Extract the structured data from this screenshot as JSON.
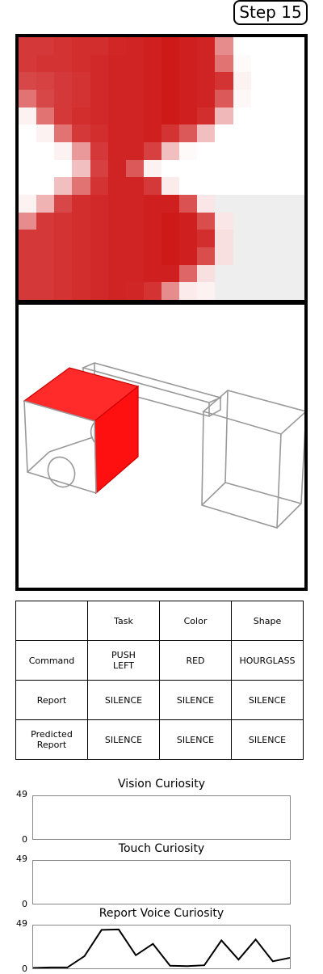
{
  "step_label": "Step 15",
  "vision": {
    "columns": 16,
    "rows": 15,
    "pixels": [
      "RRRRRRRRRRRRRRRRRRRRRRRRRRRRRRRRRRRRRRRRRRRRRRRRRRRRRRRRRRRRRRRRRRRRRRRRRRRRRRRRRRRRRRRRRRRRRRRRRRRRRRRRRRRRRRRRRRRRRRRRRRRRRRRRRRRRRRRRRRRRRRRRRRRRRRRRRRRRRRRRRRRRRRRRRRRRRRRRRRRRRRRRRRRRRRRRRRRRRRRRRRRRRRRRRRRRRRRRRRRRRRRRRRRRRRRRRRRRRRRRRRRRRRRRRRRR"
    ],
    "intensity_rows": [
      [
        0.78,
        0.78,
        0.8,
        0.82,
        0.82,
        0.85,
        0.86,
        0.88,
        0.9,
        0.88,
        0.86,
        0.45,
        0.0,
        0.0,
        0.0,
        0.0
      ],
      [
        0.78,
        0.8,
        0.8,
        0.82,
        0.84,
        0.86,
        0.86,
        0.88,
        0.9,
        0.88,
        0.86,
        0.55,
        0.02,
        0.0,
        0.0,
        0.0
      ],
      [
        0.72,
        0.74,
        0.78,
        0.8,
        0.84,
        0.86,
        0.86,
        0.88,
        0.9,
        0.88,
        0.86,
        0.8,
        0.05,
        0.0,
        0.0,
        0.0
      ],
      [
        0.55,
        0.72,
        0.78,
        0.8,
        0.84,
        0.86,
        0.86,
        0.88,
        0.9,
        0.88,
        0.86,
        0.65,
        0.03,
        0.0,
        0.0,
        0.0
      ],
      [
        0.05,
        0.55,
        0.78,
        0.82,
        0.84,
        0.86,
        0.86,
        0.88,
        0.9,
        0.88,
        0.82,
        0.28,
        0.0,
        0.0,
        0.0,
        0.0
      ],
      [
        0.0,
        0.05,
        0.55,
        0.78,
        0.82,
        0.86,
        0.86,
        0.88,
        0.8,
        0.65,
        0.25,
        0.0,
        0.0,
        0.0,
        0.0,
        0.0
      ],
      [
        0.0,
        0.0,
        0.05,
        0.4,
        0.78,
        0.86,
        0.86,
        0.75,
        0.25,
        0.02,
        0.0,
        0.0,
        0.0,
        0.0,
        0.0,
        0.0
      ],
      [
        0.0,
        0.0,
        0.0,
        0.25,
        0.75,
        0.86,
        0.65,
        0.05,
        0.0,
        0.0,
        0.0,
        0.0,
        0.0,
        0.0,
        0.0,
        0.0
      ],
      [
        0.0,
        0.0,
        0.25,
        0.55,
        0.8,
        0.86,
        0.86,
        0.78,
        0.08,
        0.0,
        0.0,
        0.0,
        0.0,
        0.0,
        0.0,
        0.0
      ],
      [
        0.05,
        0.3,
        0.72,
        0.82,
        0.84,
        0.86,
        0.86,
        0.88,
        0.88,
        0.68,
        0.1,
        0.05,
        0.05,
        0.05,
        0.05,
        0.05
      ],
      [
        0.45,
        0.78,
        0.8,
        0.82,
        0.84,
        0.86,
        0.86,
        0.88,
        0.9,
        0.88,
        0.7,
        0.1,
        0.05,
        0.05,
        0.05,
        0.05
      ],
      [
        0.78,
        0.78,
        0.8,
        0.82,
        0.84,
        0.86,
        0.86,
        0.88,
        0.9,
        0.88,
        0.82,
        0.12,
        0.05,
        0.05,
        0.05,
        0.05
      ],
      [
        0.78,
        0.78,
        0.8,
        0.82,
        0.84,
        0.86,
        0.86,
        0.88,
        0.9,
        0.88,
        0.7,
        0.12,
        0.05,
        0.05,
        0.05,
        0.05
      ],
      [
        0.78,
        0.78,
        0.8,
        0.82,
        0.84,
        0.86,
        0.86,
        0.88,
        0.88,
        0.6,
        0.12,
        0.05,
        0.05,
        0.05,
        0.05,
        0.05
      ],
      [
        0.78,
        0.78,
        0.8,
        0.82,
        0.84,
        0.86,
        0.85,
        0.8,
        0.45,
        0.08,
        0.05,
        0.05,
        0.05,
        0.05,
        0.05,
        0.05
      ]
    ]
  },
  "table": {
    "header": [
      "",
      "Task",
      "Color",
      "Shape"
    ],
    "rows": [
      [
        "Command",
        "PUSH\nLEFT",
        "RED",
        "HOURGLASS"
      ],
      [
        "Report",
        "SILENCE",
        "SILENCE",
        "SILENCE"
      ],
      [
        "Predicted\nReport",
        "SILENCE",
        "SILENCE",
        "SILENCE"
      ]
    ]
  },
  "plots": [
    {
      "title": "Vision Curiosity",
      "ymax_label": "49",
      "ymin_label": "0",
      "values": []
    },
    {
      "title": "Touch Curiosity",
      "ymax_label": "49",
      "ymin_label": "0",
      "values": []
    },
    {
      "title": "Report Voice Curiosity",
      "ymax_label": "49",
      "ymin_label": "0",
      "ymax": 49,
      "values": [
        0.5,
        1.0,
        1.0,
        14,
        44,
        44.5,
        15,
        28,
        3,
        2.5,
        3.5,
        32,
        10,
        33,
        8,
        12
      ]
    }
  ],
  "colors": {
    "object_red": "#ff0000",
    "vision_red": "#c00000"
  }
}
